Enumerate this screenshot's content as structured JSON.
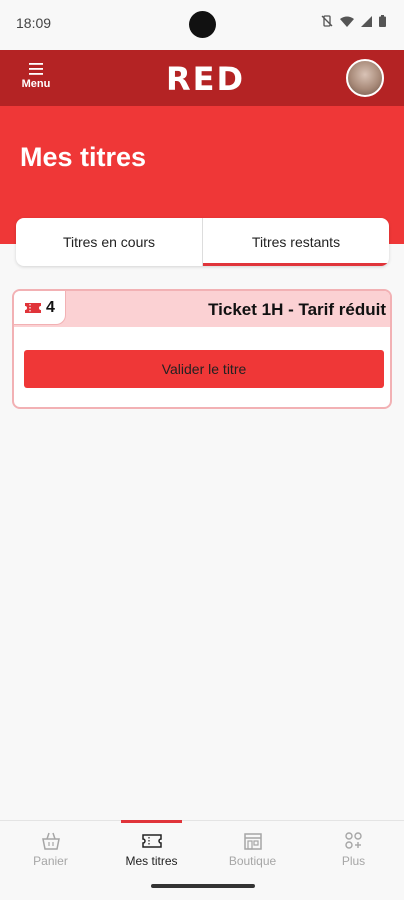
{
  "status_bar": {
    "time": "18:09"
  },
  "header": {
    "menu_label": "Menu",
    "logo_text": "RED",
    "brand_color": "#b42324"
  },
  "hero": {
    "title": "Mes titres",
    "color": "#ef3737"
  },
  "tabs": [
    {
      "label": "Titres en cours",
      "active": false
    },
    {
      "label": "Titres restants",
      "active": true
    }
  ],
  "ticket": {
    "count": "4",
    "name": "Ticket 1H - Tarif réduit",
    "validate_label": "Valider le titre"
  },
  "bottom_nav": [
    {
      "label": "Panier",
      "icon": "basket-icon",
      "active": false
    },
    {
      "label": "Mes titres",
      "icon": "ticket-icon",
      "active": true
    },
    {
      "label": "Boutique",
      "icon": "store-icon",
      "active": false
    },
    {
      "label": "Plus",
      "icon": "grid-plus-icon",
      "active": false
    }
  ]
}
